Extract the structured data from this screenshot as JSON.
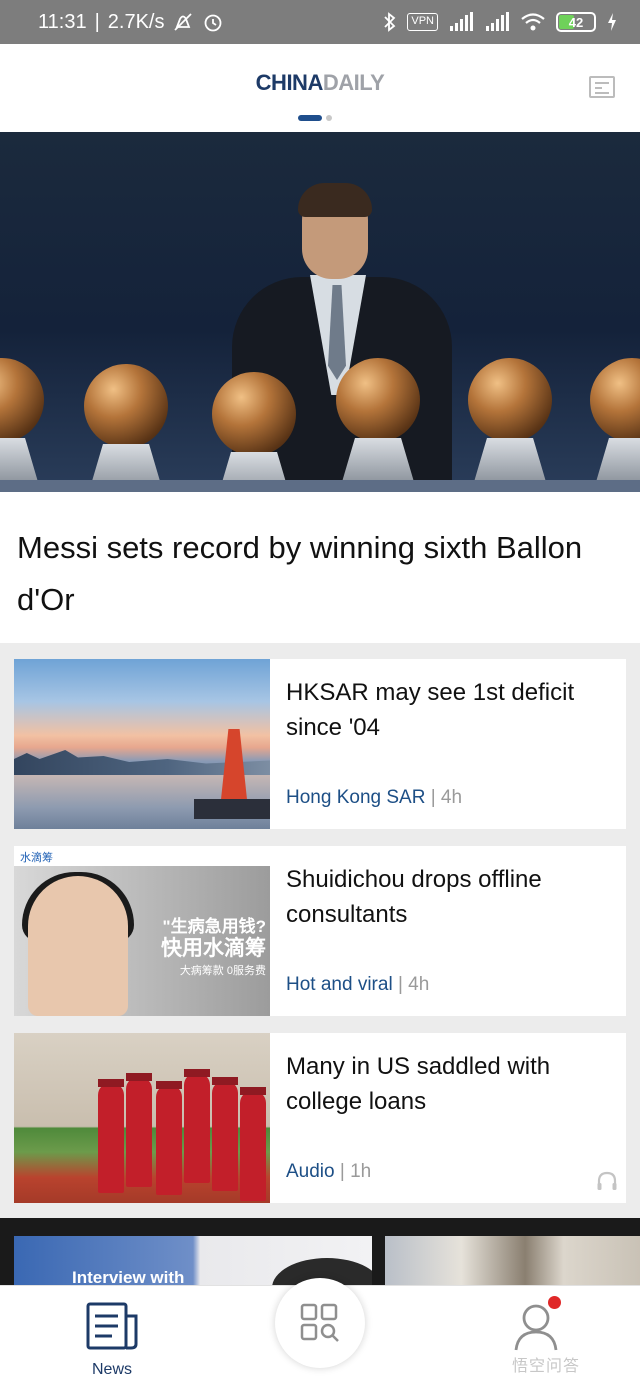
{
  "statusbar": {
    "time": "11:31",
    "speed": "2.7K/s",
    "vpn": "VPN",
    "battery": "42"
  },
  "header": {
    "logo_part1": "CHINA",
    "logo_part2": "DAILY"
  },
  "hero": {
    "headline": "Messi sets record by winning sixth Ballon d'Or"
  },
  "news": [
    {
      "title": "HKSAR may see 1st deficit since '04",
      "category": "Hong Kong SAR",
      "time": "4h"
    },
    {
      "title": "Shuidichou drops offline consultants",
      "category": "Hot and viral",
      "time": "4h",
      "ad_brand": "水滴筹",
      "ad_line1": "\"生病急用钱?",
      "ad_line2": "快用水滴筹",
      "ad_line3": "大病筹款 0服务费"
    },
    {
      "title": "Many in US saddled with college loans",
      "category": "Audio",
      "time": "1h"
    }
  ],
  "next_row": {
    "thumb_a_label": "Interview with"
  },
  "bottomnav": {
    "news_label": "News",
    "watermark": "悟空问答"
  },
  "colors": {
    "brand_navy": "#1d3a67",
    "link_blue": "#1d4f86",
    "notify_red": "#e02828"
  }
}
